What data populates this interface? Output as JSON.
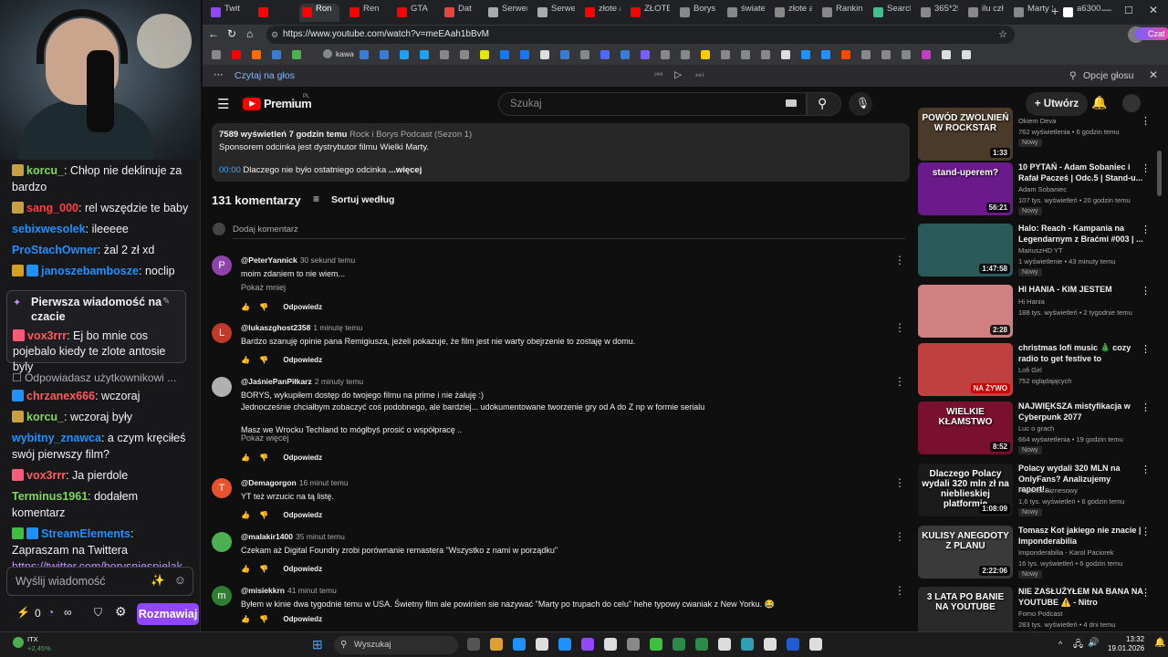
{
  "chat": {
    "messages": [
      {
        "user": "korcu_",
        "color": "#7ed957",
        "text": "Chłop nie deklinuje za bardzo",
        "badges": [
          "#c8a040"
        ]
      },
      {
        "user": "sang_000",
        "color": "#ff4040",
        "text": "rel wszędzie te baby",
        "badges": [
          "#c8a040"
        ]
      },
      {
        "user": "sebixwesolek",
        "color": "#1e90ff",
        "text": "ileeeee",
        "badges": []
      },
      {
        "user": "ProStachOwner",
        "color": "#1e90ff",
        "text": "żal 2 zł xd",
        "badges": []
      },
      {
        "user": "janoszebambosze",
        "color": "#1e90ff",
        "text": "noclip",
        "badges": [
          "#d4a020",
          "#1e90ff"
        ]
      }
    ],
    "pinned": {
      "title": "Pierwsza wiadomość na czacie",
      "user": "vox3rrr",
      "color": "#ff5a5a",
      "text": "Ej bo mnie cos pojebalo kiedy te zlote antosie byly"
    },
    "reply_label": "Odpowiadasz użytkownikowi ...",
    "messages2": [
      {
        "user": "chrzanex666",
        "color": "#ff5a5a",
        "text": "wczoraj",
        "badges": [
          "#1e90ff"
        ]
      },
      {
        "user": "korcu_",
        "color": "#7ed957",
        "text": "wczoraj były",
        "badges": [
          "#c8a040"
        ]
      },
      {
        "user": "wybitny_znawca",
        "color": "#1e90ff",
        "text": "a czym kręciłeś swój pierwszy film?",
        "badges": []
      },
      {
        "user": "vox3rrr",
        "color": "#ff5a5a",
        "text": "Ja pierdole",
        "badges": [
          "#ff5a7a"
        ]
      },
      {
        "user": "Terminus1961",
        "color": "#7ed957",
        "text": "dodałem komentarz",
        "badges": []
      },
      {
        "user": "StreamElements",
        "color": "#1e90ff",
        "text": "Zapraszam na Twittera",
        "badges": [
          "#3fbf3f",
          "#1e90ff"
        ]
      }
    ],
    "link": "https://twitter.com/borysniespielak",
    "input_placeholder": "Wyślij wiadomość",
    "points": "0",
    "chat_button": "Rozmawiaj"
  },
  "browser": {
    "tabs": [
      "Twit",
      "",
      "Ron",
      "Ren",
      "GTA",
      "Dat",
      "Serwer",
      "Serwer",
      "złote ar",
      "ZŁOTE A",
      "Borys N",
      "światek",
      "złote an",
      "Ranking",
      "Search:",
      "365*25",
      "ilu człon",
      "Marty S",
      "a6300"
    ],
    "tab_colors": [
      "#9147ff",
      "#ff0000",
      "#ff0000",
      "#ff0000",
      "#ff0000",
      "#e8453c",
      "#aaaaaa",
      "#aaaaaa",
      "#ff0000",
      "#ff0000",
      "#888888",
      "#888888",
      "#888888",
      "#888888",
      "#3fbf8f",
      "#888888",
      "#888888",
      "#888888",
      "#ffffff"
    ],
    "url": "https://www.youtube.com/watch?v=meEAah1bBvM",
    "bookmark_label": "kawa",
    "read_aloud": "Czytaj na głos",
    "voice_options": "Opcje głosu",
    "profile_label": "Czat"
  },
  "youtube": {
    "logo": "Premium",
    "logo_sup": "PL",
    "search_placeholder": "Szukaj",
    "create": "Utwórz",
    "desc": {
      "views": "7589 wyświetleń",
      "time": "7 godzin temu",
      "playlist": "Rock i Borys Podcast (Sezon 1)",
      "sponsor": "Sponsorem odcinka jest dystrybutor filmu Wielki Marty.",
      "chapter_time": "00:00",
      "chapter": "Dlaczego nie było ostatniego odcinka",
      "more": "...więcej"
    },
    "comment_count": "131 komentarzy",
    "sort": "Sortuj według",
    "add_comment": "Dodaj komentarz",
    "reply_label": "Odpowiedz",
    "comments": [
      {
        "avatar": "P",
        "avatar_color": "#8e44ad",
        "handle": "@PeterYannick",
        "time": "30 sekund temu",
        "text": "moim zdaniem to nie wiem...",
        "more": "Pokaż mniej"
      },
      {
        "avatar": "L",
        "avatar_color": "#c0392b",
        "handle": "@lukaszghost2358",
        "time": "1 minutę temu",
        "text": "Bardzo szanuję opinie pana Remigiusza, jeżeli pokazuje, że film jest nie warty obejrzenie to zostaję w domu.",
        "more": ""
      },
      {
        "avatar": "",
        "avatar_color": "#b0b0b0",
        "handle": "@JaśniePanPiłkarz",
        "time": "2 minuty temu",
        "text": "BORYS, wykupiłem dostęp do twojego filmu na prime i nie żałuję :)\nJednocześnie chciałbym zobaczyć coś podobnego, ale bardziej... udokumentowane tworzenie gry od A do Z np w formie serialu\n\nMasz we Wrocku Techland to mógłbyś prosić o współpracę ..",
        "more": "Pokaż więcej"
      },
      {
        "avatar": "T",
        "avatar_color": "#e6532e",
        "handle": "@Demagorgon",
        "time": "16 minut temu",
        "text": "YT też wrzucic na tą listę.",
        "more": ""
      },
      {
        "avatar": "",
        "avatar_color": "#4caf50",
        "handle": "@malakir1400",
        "time": "35 minut temu",
        "text": "Czekam aż Digital Foundry zrobi porównanie remastera \"Wszystko z nami w porządku\"",
        "more": ""
      },
      {
        "avatar": "m",
        "avatar_color": "#2e7d32",
        "handle": "@misiekkrn",
        "time": "41 minut temu",
        "text": "Byłem w kinie dwa tygodnie temu w USA. Świetny film ale powinien sie nazywać \"Marty po trupach do celu\" hehe typowy cwaniak z New Yorku. 😂",
        "more": ""
      }
    ],
    "recs": [
      {
        "title": "",
        "channel": "Okiem Devа",
        "meta": "762 wyświetlenia • 6 godzin temu",
        "badge": "Nowy",
        "dur": "1:33",
        "thumb_text": "POWÓD ZWOLNIEŃ W ROCKSTAR",
        "thumb_color": "#4a3a2a"
      },
      {
        "title": "10 PYTAŃ - Adam Sobaniec i Rafał Pacześ | Odc.5 | Stand-u...",
        "channel": "Adam Sobaniec",
        "meta": "107 tys. wyświetleń • 20 godzin temu",
        "badge": "Nowy",
        "dur": "56:21",
        "thumb_text": "stand-uperem?",
        "thumb_color": "#6a1a8a"
      },
      {
        "title": "Halo: Reach - Kampania na Legendarnym z Braćmi #003 | ...",
        "channel": "MariuszHD YT",
        "meta": "1 wyświetlenie • 43 minuty temu",
        "badge": "Nowy",
        "dur": "1:47:58",
        "thumb_text": "",
        "thumb_color": "#2a5a5a"
      },
      {
        "title": "HI HANIA - KIM JESTEM",
        "channel": "Hi Hania",
        "meta": "188 tys. wyświetleń • 2 tygodnie temu",
        "badge": "",
        "dur": "2:28",
        "thumb_text": "",
        "thumb_color": "#d08080"
      },
      {
        "title": "christmas lofi music 🎄 cozy radio to get festive to",
        "channel": "Lofi Girl",
        "meta": "752 oglądających",
        "badge": "",
        "dur": "NA ŻYWO",
        "thumb_text": "",
        "thumb_color": "#c04040"
      },
      {
        "title": "NAJWIĘKSZA mistyfikacja w Cyberpunk 2077",
        "channel": "Luc o grach",
        "meta": "664 wyświetlenia • 19 godzin temu",
        "badge": "Nowy",
        "dur": "8:52",
        "thumb_text": "WIELKIE KŁAMSTWO",
        "thumb_color": "#7a1030"
      },
      {
        "title": "Polacy wydali 320 MLN na OnlyFans? Analizujemy raport!...",
        "channel": "Podcast Biznesowy",
        "meta": "1,6 tys. wyświetleń • 6 godzin temu",
        "badge": "Nowy",
        "dur": "1:08:09",
        "thumb_text": "Dlaczego Polacy wydali 320 mln zł na nieblieskiej platformie",
        "thumb_color": "#1a1a1a"
      },
      {
        "title": "Tomasz Kot jakiego nie znacie | Imponderabilia",
        "channel": "Imponderabilia - Karol Paciorek",
        "meta": "16 tys. wyświetleń • 6 godzin temu",
        "badge": "Nowy",
        "dur": "2:22:06",
        "thumb_text": "KULISY ANEGDOTY Z PLANU",
        "thumb_color": "#3a3a3a"
      },
      {
        "title": "NIE ZASŁUŻYŁEM NA BANA NA YOUTUBE ⚠️ - Nitro",
        "channel": "Fomo Podcast",
        "meta": "283 tys. wyświetleń • 4 dni temu",
        "badge": "",
        "dur": "",
        "thumb_text": "3 LATA PO BANIE NA YOUTUBE",
        "thumb_color": "#2a2a2a"
      }
    ]
  },
  "taskbar": {
    "weather_title": "ITX",
    "weather_value": "+2,45%",
    "search": "Wyszukaj",
    "time": "13:32",
    "date": "19.01.2026"
  },
  "colors": {
    "accent": "#9147ff",
    "yt_red": "#ff0000",
    "link": "#3ea6ff"
  }
}
